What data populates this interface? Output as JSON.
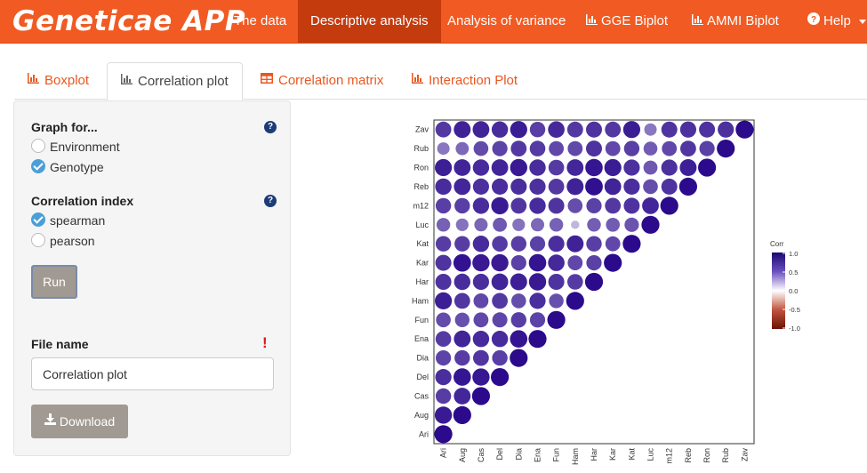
{
  "brand": "Geneticae APP",
  "nav": [
    {
      "label": "The data",
      "icon": "",
      "active": false
    },
    {
      "label": "Descriptive analysis",
      "icon": "",
      "active": true
    },
    {
      "label": "Analysis of variance",
      "icon": "",
      "active": false
    },
    {
      "label": "GGE Biplot",
      "icon": "bar-chart-icon",
      "active": false
    },
    {
      "label": "AMMI Biplot",
      "icon": "bar-chart-icon",
      "active": false
    },
    {
      "label": "Help",
      "icon": "question-circle-icon",
      "active": false
    }
  ],
  "tabs": [
    {
      "label": "Boxplot",
      "icon": "bar-chart-icon",
      "active": false
    },
    {
      "label": "Correlation plot",
      "icon": "bar-chart-icon",
      "active": true
    },
    {
      "label": "Correlation matrix",
      "icon": "table-icon",
      "active": false
    },
    {
      "label": "Interaction Plot",
      "icon": "bar-chart-icon",
      "active": false
    }
  ],
  "sidebar": {
    "graph_for": {
      "label": "Graph for...",
      "options": [
        {
          "label": "Environment",
          "checked": false
        },
        {
          "label": "Genotype",
          "checked": true
        }
      ]
    },
    "corr_index": {
      "label": "Correlation index",
      "options": [
        {
          "label": "spearman",
          "checked": true
        },
        {
          "label": "pearson",
          "checked": false
        }
      ]
    },
    "run_label": "Run",
    "file_name": {
      "label": "File name",
      "required_mark": "!",
      "value": "Correlation plot"
    },
    "download_label": "Download"
  },
  "chart_data": {
    "type": "heatmap",
    "title": "",
    "variables": [
      "Ari",
      "Aug",
      "Cas",
      "Del",
      "Dia",
      "Ena",
      "Fun",
      "Ham",
      "Har",
      "Kar",
      "Kat",
      "Luc",
      "m12",
      "Reb",
      "Ron",
      "Rub",
      "Zav"
    ],
    "legend": {
      "title": "Corr",
      "ticks": [
        "1.0",
        "0.5",
        "0.0",
        "-0.5",
        "-1.0"
      ],
      "range": [
        -1,
        1
      ],
      "placement": "right"
    },
    "colors": {
      "positive": "#2b0a8c",
      "neutral": "#ffffff",
      "negative": "#7a1b0d"
    },
    "matrix": [
      [
        1.0
      ],
      [
        0.92,
        1.0
      ],
      [
        0.75,
        0.86,
        1.0
      ],
      [
        0.82,
        0.94,
        0.93,
        1.0
      ],
      [
        0.72,
        0.75,
        0.78,
        0.74,
        1.0
      ],
      [
        0.76,
        0.87,
        0.84,
        0.84,
        0.95,
        1.0
      ],
      [
        0.68,
        0.66,
        0.7,
        0.71,
        0.74,
        0.72,
        1.0
      ],
      [
        0.9,
        0.78,
        0.7,
        0.77,
        0.67,
        0.82,
        0.66,
        1.0
      ],
      [
        0.8,
        0.83,
        0.82,
        0.87,
        0.89,
        0.92,
        0.8,
        0.76,
        1.0
      ],
      [
        0.79,
        0.96,
        0.92,
        0.92,
        0.73,
        0.95,
        0.85,
        0.7,
        0.73,
        1.0
      ],
      [
        0.75,
        0.75,
        0.84,
        0.76,
        0.74,
        0.73,
        0.82,
        0.88,
        0.74,
        0.7,
        1.0
      ],
      [
        0.58,
        0.5,
        0.56,
        0.62,
        0.5,
        0.55,
        0.58,
        0.22,
        0.59,
        0.6,
        0.64,
        1.0
      ],
      [
        0.74,
        0.74,
        0.83,
        0.92,
        0.78,
        0.84,
        0.79,
        0.67,
        0.73,
        0.77,
        0.8,
        0.86,
        1.0
      ],
      [
        0.83,
        0.86,
        0.81,
        0.82,
        0.82,
        0.81,
        0.77,
        0.88,
        0.97,
        0.87,
        0.82,
        0.67,
        0.8,
        1.0
      ],
      [
        0.9,
        0.87,
        0.84,
        0.87,
        0.92,
        0.83,
        0.76,
        0.86,
        0.94,
        0.91,
        0.81,
        0.62,
        0.81,
        0.89,
        1.0
      ],
      [
        0.48,
        0.54,
        0.68,
        0.72,
        0.77,
        0.76,
        0.7,
        0.69,
        0.8,
        0.7,
        0.74,
        0.6,
        0.7,
        0.78,
        0.73,
        1.0
      ],
      [
        0.77,
        0.88,
        0.87,
        0.83,
        0.91,
        0.74,
        0.85,
        0.77,
        0.8,
        0.77,
        0.91,
        0.48,
        0.79,
        0.81,
        0.8,
        0.81,
        1.0
      ]
    ]
  }
}
